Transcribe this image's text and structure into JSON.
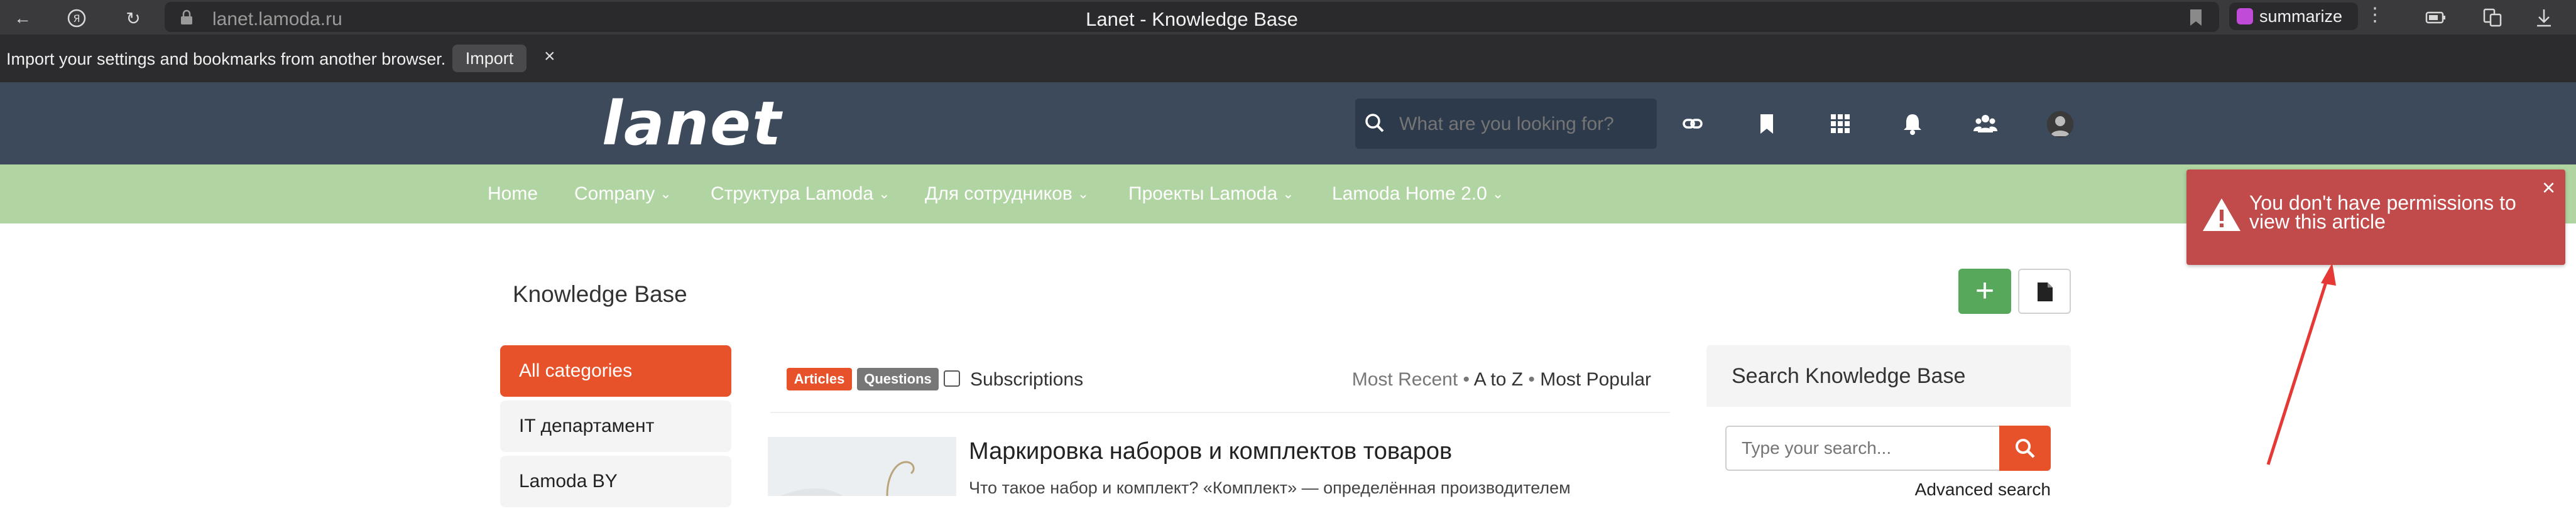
{
  "browser": {
    "url": "lanet.lamoda.ru",
    "title": "Lanet - Knowledge Base",
    "summarize_label": "summarize",
    "more_label": "⋮"
  },
  "import_bar": {
    "message": "Import your settings and bookmarks from another browser.",
    "button_label": "Import",
    "close_label": "×"
  },
  "header": {
    "logo": "lanet",
    "search_placeholder": "What are you looking for?"
  },
  "nav": {
    "items": [
      {
        "label": "Home"
      },
      {
        "label": "Company",
        "chevron": "⌄"
      },
      {
        "label": "Структура Lamoda",
        "chevron": "⌄"
      },
      {
        "label": "Для сотрудников",
        "chevron": "⌄"
      },
      {
        "label": "Проекты Lamoda",
        "chevron": "⌄"
      },
      {
        "label": "Lamoda Home 2.0",
        "chevron": "⌄"
      }
    ]
  },
  "page": {
    "title": "Knowledge Base",
    "add_label": "+"
  },
  "sidebar": {
    "items": [
      {
        "label": "All categories"
      },
      {
        "label": "IT департамент"
      },
      {
        "label": "Lamoda BY"
      }
    ]
  },
  "filters": {
    "tag_articles": "Articles",
    "tag_questions": "Questions",
    "subscriptions": "Subscriptions",
    "sort_recent": "Most Recent",
    "sort_az": "A to Z",
    "sort_popular": "Most Popular",
    "sep": " • "
  },
  "article": {
    "title": "Маркировка наборов и комплектов товаров",
    "excerpt": "Что такое набор и комплект? «Комплект» — определённая производителем"
  },
  "kb_search": {
    "heading": "Search Knowledge Base",
    "placeholder": "Type your search...",
    "advanced": "Advanced search"
  },
  "alert": {
    "message": "You don't have permissions to view this article",
    "close_label": "×",
    "color": "#c14b4b"
  },
  "colors": {
    "brand_orange": "#e8522a",
    "nav_green": "#b0d4a2",
    "header_navy": "#3c4a5c",
    "add_green": "#57a85a"
  }
}
